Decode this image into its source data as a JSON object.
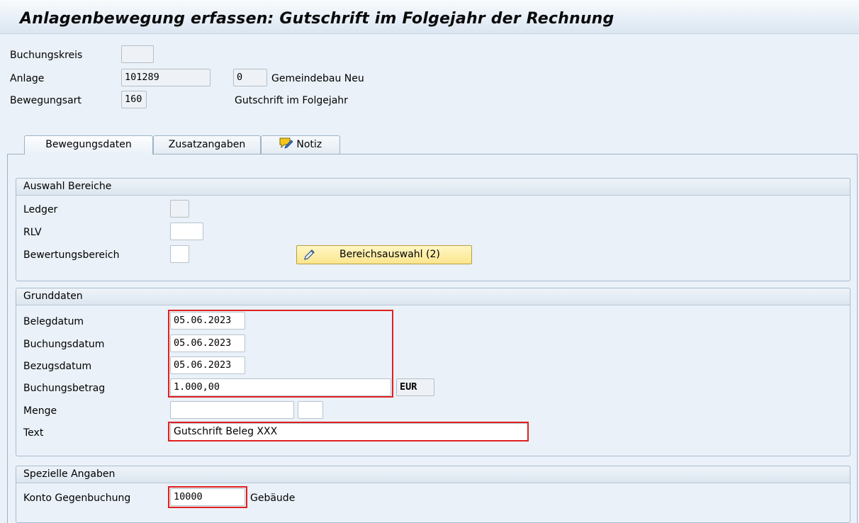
{
  "title": "Anlagenbewegung erfassen: Gutschrift im Folgejahr der Rechnung",
  "header": {
    "buchungskreis_label": "Buchungskreis",
    "buchungskreis_value": "",
    "anlage_label": "Anlage",
    "anlage_value": "101289",
    "unternummer_value": "0",
    "anlage_desc": "Gemeindebau Neu",
    "bewegungsart_label": "Bewegungsart",
    "bewegungsart_value": "160",
    "bewegungsart_desc": "Gutschrift im Folgejahr"
  },
  "tabs": [
    {
      "label": "Bewegungsdaten",
      "active": true
    },
    {
      "label": "Zusatzangaben",
      "active": false
    },
    {
      "label": "Notiz",
      "active": false,
      "icon": "note-pencil-icon"
    }
  ],
  "auswahl": {
    "title": "Auswahl Bereiche",
    "ledger_label": "Ledger",
    "rlv_label": "RLV",
    "bewertungsbereich_label": "Bewertungsbereich",
    "button_label": "Bereichsauswahl (2)",
    "button_icon": "pencil-icon"
  },
  "grunddaten": {
    "title": "Grunddaten",
    "belegdatum_label": "Belegdatum",
    "belegdatum_value": "05.06.2023",
    "buchungsdatum_label": "Buchungsdatum",
    "buchungsdatum_value": "05.06.2023",
    "bezugsdatum_label": "Bezugsdatum",
    "bezugsdatum_value": "05.06.2023",
    "buchungsbetrag_label": "Buchungsbetrag",
    "buchungsbetrag_value": "1.000,00",
    "currency": "EUR",
    "menge_label": "Menge",
    "menge_value": "",
    "text_label": "Text",
    "text_value": "Gutschrift Beleg XXX"
  },
  "speziell": {
    "title": "Spezielle Angaben",
    "konto_label": "Konto Gegenbuchung",
    "konto_value": "10000",
    "konto_desc": "Gebäude"
  },
  "colors": {
    "background": "#eaf1f8",
    "highlight": "#e02020",
    "button": "#fbe58d"
  }
}
